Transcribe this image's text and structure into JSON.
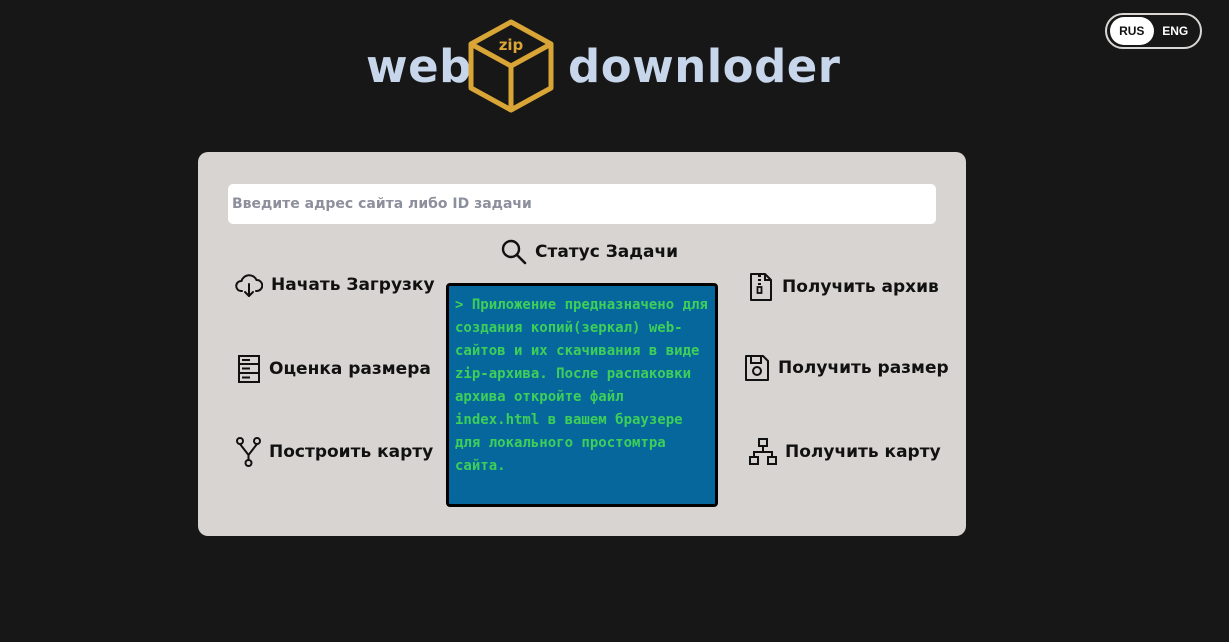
{
  "lang_switch": {
    "active": "RUS",
    "inactive": "ENG"
  },
  "logo": {
    "left_word": "web",
    "right_word": "downloder",
    "box_label": "zip",
    "box_color": "#d9a536",
    "text_color": "#c7d6ea"
  },
  "search": {
    "placeholder": "Введите адрес сайта либо ID задачи",
    "value": ""
  },
  "status_button": {
    "label": "Статус Задачи",
    "icon": "search-icon"
  },
  "left_actions": [
    {
      "label": "Начать Загрузку",
      "icon": "cloud-download-icon"
    },
    {
      "label": "Оценка размера",
      "icon": "server-icon"
    },
    {
      "label": "Построить карту",
      "icon": "git-fork-icon"
    }
  ],
  "right_actions": [
    {
      "label": "Получить архив",
      "icon": "zip-file-icon"
    },
    {
      "label": "Получить размер",
      "icon": "floppy-disk-icon"
    },
    {
      "label": "Получить карту",
      "icon": "sitemap-icon"
    }
  ],
  "console": {
    "text": "> Приложение предназначено для создания копий(зеркал) web-сайтов и их скачивания в виде zip-архива. После распаковки архива откройте файл index.html в вашем браузере для локального простомтра сайта.",
    "background": "#05679c",
    "text_color": "#3ecf59"
  },
  "colors": {
    "page_bg": "#171717",
    "panel_bg": "#d8d4d1"
  }
}
